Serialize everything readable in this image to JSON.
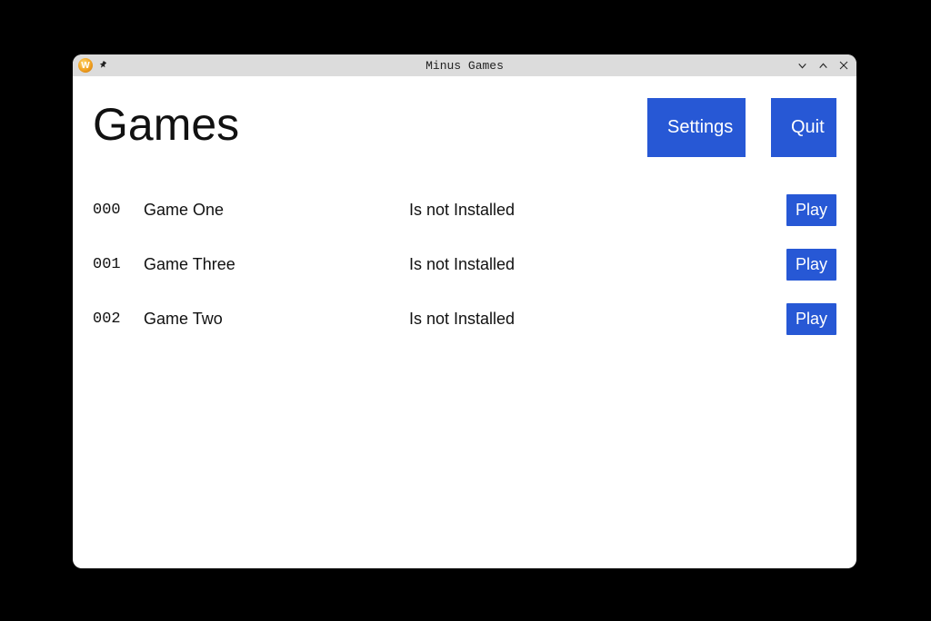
{
  "window": {
    "title": "Minus Games",
    "app_icon_letter": "W"
  },
  "header": {
    "page_title": "Games",
    "settings_label": "Settings",
    "quit_label": "Quit"
  },
  "games": [
    {
      "id": "000",
      "name": "Game One",
      "status": "Is not Installed",
      "action": "Play"
    },
    {
      "id": "001",
      "name": "Game Three",
      "status": "Is not Installed",
      "action": "Play"
    },
    {
      "id": "002",
      "name": "Game Two",
      "status": "Is not Installed",
      "action": "Play"
    }
  ]
}
